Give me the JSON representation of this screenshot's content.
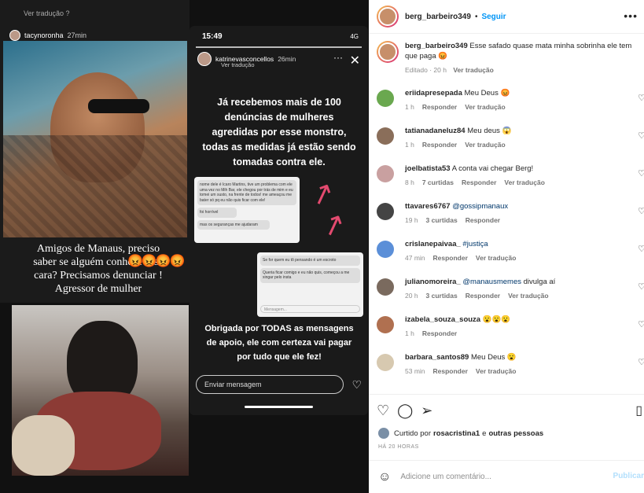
{
  "post": {
    "author": "berg_barbeiro349",
    "follow_label": "Seguir",
    "caption_user": "berg_barbeiro349",
    "caption_text": "Esse safado quase mata minha sobrinha ele tem que paga 😡",
    "caption_meta_edited": "Editado · 20 h",
    "caption_meta_translate": "Ver tradução"
  },
  "story_left": {
    "faded_top": "Ver tradução ?",
    "user": "tacynoronha",
    "time": "27min",
    "emojis": "😡😡😡😡",
    "caption": "Amigos de Manaus, preciso saber se alguém conhece esse cara? Precisamos denunciar ! Agressor de mulher"
  },
  "story_right": {
    "time": "15:49",
    "status": "4G",
    "user": "katrinevasconcellos",
    "user_time": "26min",
    "translate": "Ver tradução",
    "text1": "Já recebemos mais de 100 denúncias de mulheres agredidas por esse monstro, todas as medidas já estão sendo tomadas contra ele.",
    "chat1_lines": [
      "nome dele é Icaro Martins, tive um problema com ele uma vez no Mih Bar, ele chegou por trás de mim e eu tomei um susto, na frente de todos! me ameaçou me bater só pq eu não quis ficar com ele!",
      "foi horrível",
      "mas os seguranças me ajudaram"
    ],
    "chat2_lines": [
      "Se for quem eu tô pensando é um escroto",
      "Queria ficar comigo e eu não quis, começou a me xingar pelo insta"
    ],
    "chat2_placeholder": "Mensagem...",
    "text2": "Obrigada por TODAS as mensagens de apoio, ele com certeza vai pagar por tudo que ele fez!",
    "send_placeholder": "Enviar mensagem"
  },
  "comments": [
    {
      "user": "eriidapresepada",
      "text": "Meu Deus 😡",
      "time": "1 h",
      "likes": "",
      "reply": "Responder",
      "translate": "Ver tradução",
      "avatar_color": "#6aa84f"
    },
    {
      "user": "tatianadaneluz84",
      "text": "Meu deus 😱",
      "time": "1 h",
      "likes": "",
      "reply": "Responder",
      "translate": "Ver tradução",
      "avatar_color": "#8a6e5a"
    },
    {
      "user": "joelbatista53",
      "text": "A conta vai chegar Berg!",
      "time": "8 h",
      "likes": "7 curtidas",
      "reply": "Responder",
      "translate": "Ver tradução",
      "avatar_color": "#c9a0a0"
    },
    {
      "user": "ttavares6767",
      "text": "@gossipmanaux",
      "time": "19 h",
      "likes": "3 curtidas",
      "reply": "Responder",
      "translate": "",
      "avatar_color": "#444444",
      "mention": true
    },
    {
      "user": "crislanepaivaa_",
      "text": "#justiça",
      "time": "47 min",
      "likes": "",
      "reply": "Responder",
      "translate": "Ver tradução",
      "avatar_color": "#5b8fd8",
      "mention": true
    },
    {
      "user": "julianomoreira_",
      "text": "@manausmemes divulga aí",
      "time": "20 h",
      "likes": "3 curtidas",
      "reply": "Responder",
      "translate": "Ver tradução",
      "avatar_color": "#7a6a5e",
      "partial_mention": "@manausmemes",
      "rest": " divulga aí"
    },
    {
      "user": "izabela_souza_souza",
      "text": "😮😮😮",
      "time": "1 h",
      "likes": "",
      "reply": "Responder",
      "translate": "",
      "avatar_color": "#b07050"
    },
    {
      "user": "barbara_santos89",
      "text": "Meu Deus 😮",
      "time": "53 min",
      "likes": "",
      "reply": "Responder",
      "translate": "Ver tradução",
      "avatar_color": "#d7c9b0"
    }
  ],
  "liked_by": {
    "prefix": "Curtido por",
    "user": "rosacristina1",
    "and": "e",
    "others": "outras pessoas"
  },
  "time_ago": "HÁ 20 HORAS",
  "add_comment": {
    "placeholder": "Adicione um comentário...",
    "publish": "Publicar"
  },
  "icons": {
    "more": "more-icon",
    "heart": "heart-icon",
    "comment": "comment-icon",
    "share": "share-icon",
    "save": "bookmark-icon",
    "emoji": "emoji-icon"
  },
  "colors": {
    "accent": "#0095f6",
    "publish_disabled": "#b2dffc",
    "link": "#00376b"
  }
}
